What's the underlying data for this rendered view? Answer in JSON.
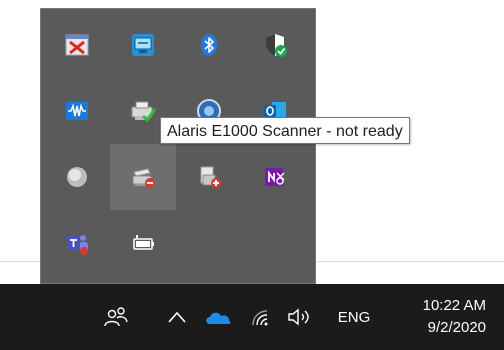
{
  "tooltip": {
    "text": "Alaris E1000 Scanner - not ready"
  },
  "tray_icons": [
    {
      "icon": "red-x-window-icon"
    },
    {
      "icon": "blue-monitor-app-icon"
    },
    {
      "icon": "bluetooth-icon"
    },
    {
      "icon": "windows-security-shield-icon"
    },
    {
      "icon": "waveform-audio-icon"
    },
    {
      "icon": "printer-ready-icon"
    },
    {
      "icon": "blue-circle-app-icon"
    },
    {
      "icon": "outlook-icon"
    },
    {
      "icon": "gray-disc-icon"
    },
    {
      "icon": "scanner-not-ready-icon"
    },
    {
      "icon": "scanner-add-icon"
    },
    {
      "icon": "onenote-send-icon"
    },
    {
      "icon": "teams-icon"
    },
    {
      "icon": "battery-icon"
    }
  ],
  "taskbar": {
    "language": "ENG",
    "time": "10:22 AM",
    "date": "9/2/2020",
    "icons": [
      "people-icon",
      "chevron-up-icon",
      "onedrive-cloud-icon",
      "wifi-icon",
      "volume-icon"
    ]
  },
  "colors": {
    "flyout_bg": "#5a5a5a",
    "taskbar_bg": "#1b1b1b",
    "onedrive_blue": "#1c8ae6"
  }
}
